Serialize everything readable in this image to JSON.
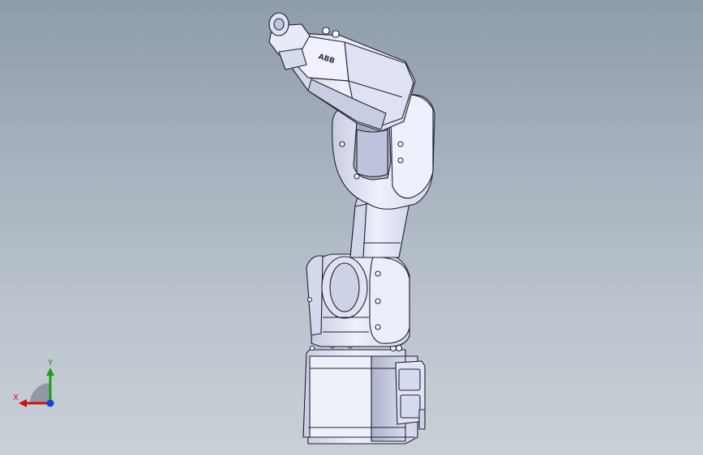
{
  "viewport": {
    "background_top": "#8f9cac",
    "background_bottom": "#c9d0d7"
  },
  "model": {
    "label": "ABB",
    "part_color": "#e6e8f6",
    "line_color": "#1e2130"
  },
  "triad": {
    "x_label": "X",
    "y_label": "Y",
    "x_color": "#d01010",
    "y_color": "#18a018",
    "origin_color": "#1a3fd8"
  }
}
